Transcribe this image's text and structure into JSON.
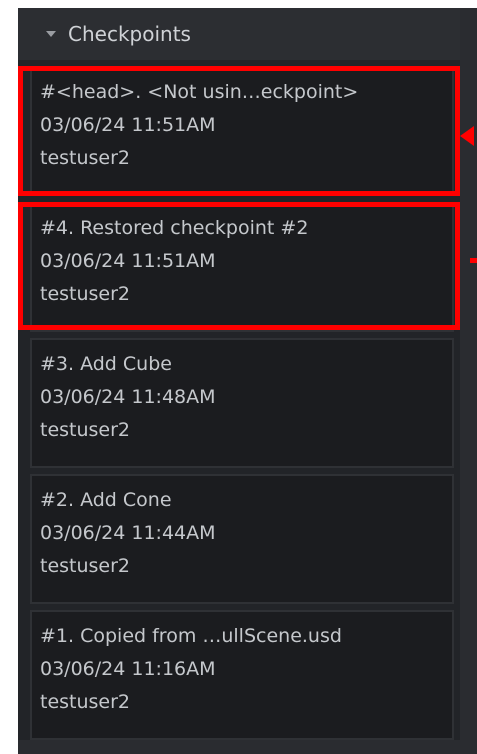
{
  "panel": {
    "title": "Checkpoints"
  },
  "checkpoints": [
    {
      "label": "#<head>.   <Not usin…eckpoint>",
      "datetime": "03/06/24 11:51AM",
      "user": "testuser2"
    },
    {
      "label": "#4.   Restored checkpoint #2",
      "datetime": "03/06/24 11:51AM",
      "user": "testuser2"
    },
    {
      "label": "#3.   Add Cube",
      "datetime": "03/06/24 11:48AM",
      "user": "testuser2"
    },
    {
      "label": "#2.   Add Cone",
      "datetime": "03/06/24 11:44AM",
      "user": "testuser2"
    },
    {
      "label": "#1.   Copied from …ullScene.usd",
      "datetime": "03/06/24 11:16AM",
      "user": "testuser2"
    }
  ],
  "colors": {
    "highlight": "#ff0000",
    "panel_bg": "#222428",
    "item_bg": "#1b1c1f",
    "text": "#c5c8cc"
  },
  "icons": {
    "collapse": "triangle-down-icon"
  }
}
